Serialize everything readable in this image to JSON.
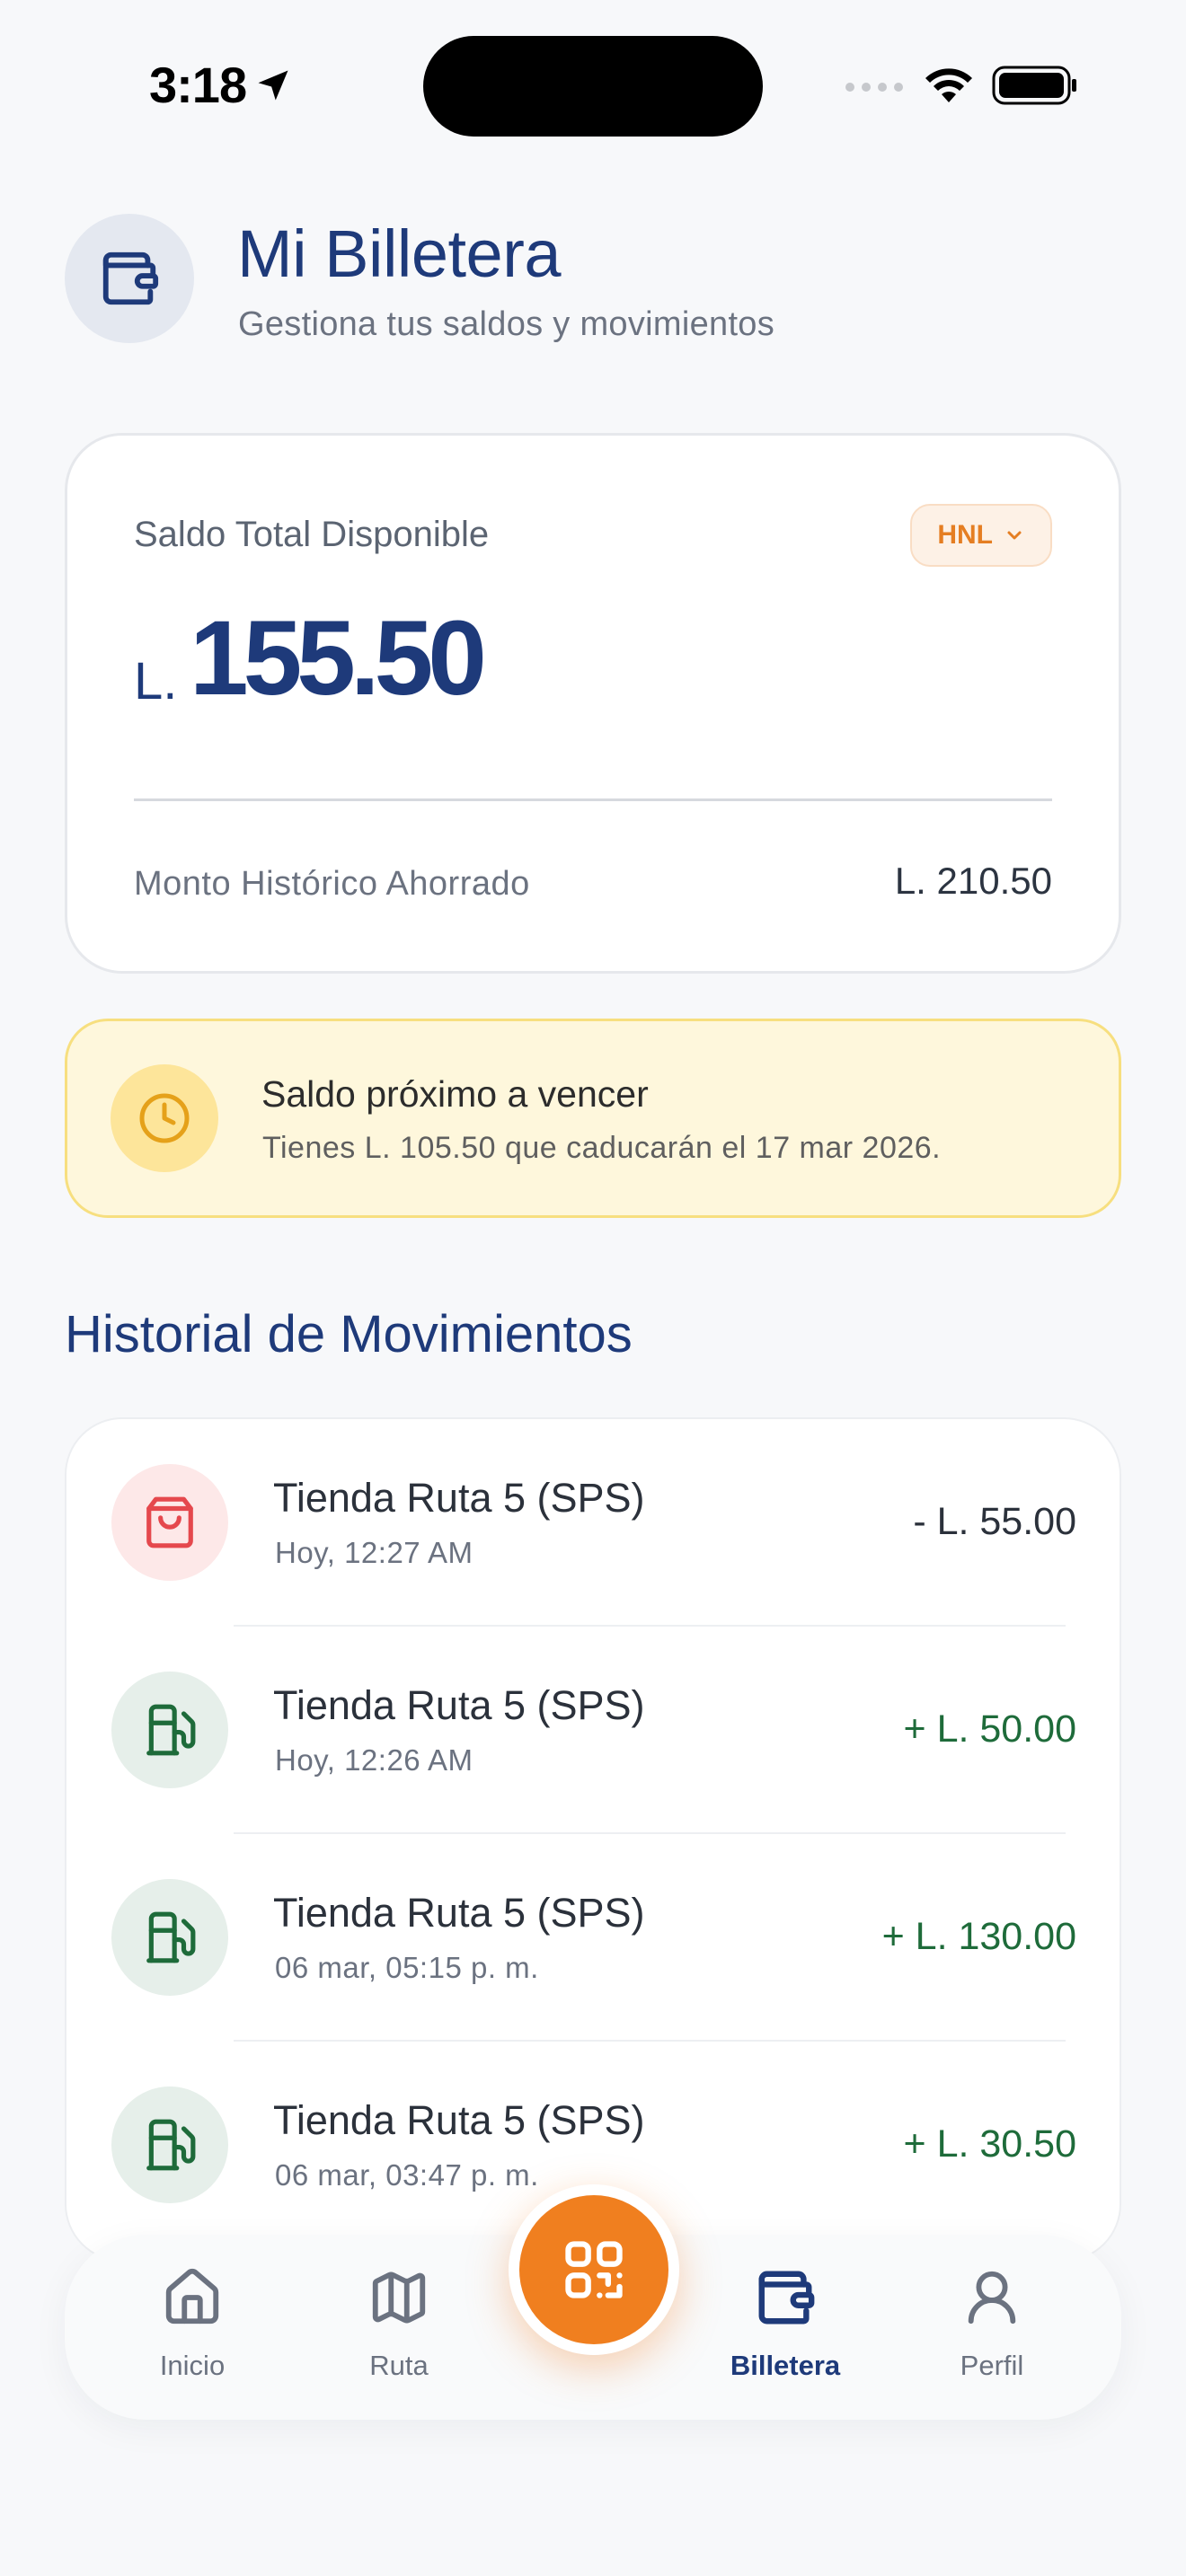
{
  "status_bar": {
    "time": "3:18"
  },
  "header": {
    "title": "Mi Billetera",
    "subtitle": "Gestiona tus saldos y movimientos",
    "icon": "wallet-icon"
  },
  "balance_card": {
    "label": "Saldo Total Disponible",
    "currency_selector": "HNL",
    "prefix": "L.",
    "amount": "155.50",
    "history_label": "Monto Histórico Ahorrado",
    "history_value": "L. 210.50"
  },
  "expiry_banner": {
    "icon": "clock-icon",
    "title": "Saldo próximo a vencer",
    "text": "Tienes L. 105.50 que caducarán el 17 mar 2026."
  },
  "transactions": {
    "title": "Historial de Movimientos",
    "items": [
      {
        "merchant": "Tienda Ruta 5 (SPS)",
        "date": "Hoy, 12:27 AM",
        "amount": "- L. 55.00",
        "type": "debit",
        "icon": "shopping-bag-icon"
      },
      {
        "merchant": "Tienda Ruta 5 (SPS)",
        "date": "Hoy, 12:26 AM",
        "amount": "+ L. 50.00",
        "type": "credit",
        "icon": "fuel-pump-icon"
      },
      {
        "merchant": "Tienda Ruta 5 (SPS)",
        "date": "06 mar, 05:15 p. m.",
        "amount": "+ L. 130.00",
        "type": "credit",
        "icon": "fuel-pump-icon"
      },
      {
        "merchant": "Tienda Ruta 5 (SPS)",
        "date": "06 mar, 03:47 p. m.",
        "amount": "+ L. 30.50",
        "type": "credit",
        "icon": "fuel-pump-icon"
      }
    ]
  },
  "bottom_nav": {
    "items": [
      {
        "label": "Inicio",
        "icon": "home-icon"
      },
      {
        "label": "Ruta",
        "icon": "map-icon"
      },
      {
        "label": "Billetera",
        "icon": "wallet-icon",
        "active": true
      },
      {
        "label": "Perfil",
        "icon": "user-icon"
      }
    ],
    "fab_icon": "qr-code-icon"
  },
  "colors": {
    "primary": "#1e3a7a",
    "accent": "#f07f1f",
    "credit": "#1e6b3a",
    "debit_icon": "#e5484d",
    "warning_bg": "#fef7dc"
  }
}
